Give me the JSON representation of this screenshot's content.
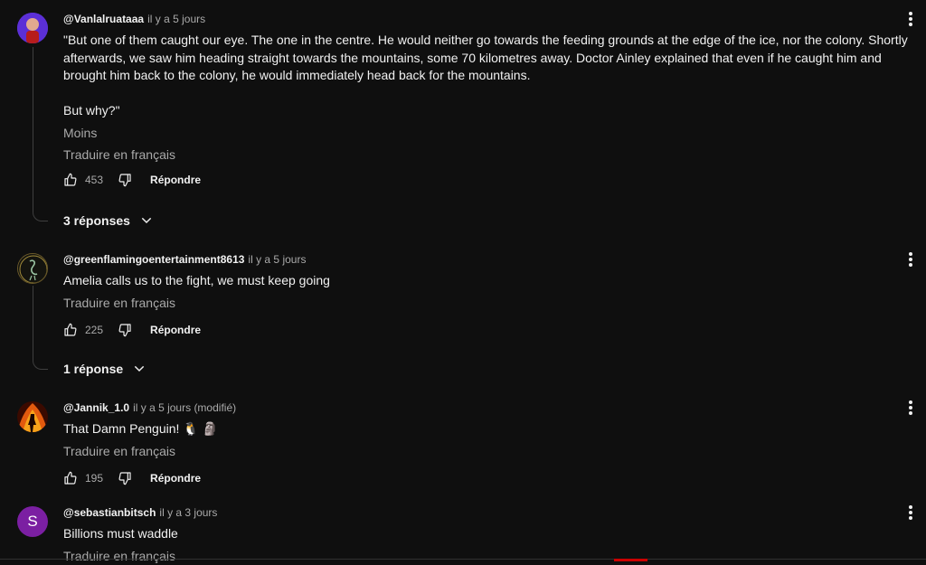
{
  "comments": [
    {
      "author": "@Vanlalruataaa",
      "time": "il y a 5 jours",
      "paragraph1": "\"But one of them caught our eye. The one in the centre. He would neither go towards the feeding grounds at the edge of the ice, nor the colony. Shortly afterwards, we saw him heading straight towards the mountains, some 70 kilometres away. Doctor Ainley explained that even if he caught him and brought him back to the colony, he would immediately head back for the mountains.",
      "paragraph2": "But why?\"",
      "less_label": "Moins",
      "translate_label": "Traduire en français",
      "likes": "453",
      "reply_label": "Répondre",
      "replies_label": "3 réponses",
      "avatar_color": "#6a3de8"
    },
    {
      "author": "@greenflamingoentertainment8613",
      "time": "il y a 5 jours",
      "text": "Amelia calls us to the fight, we must keep going",
      "translate_label": "Traduire en français",
      "likes": "225",
      "reply_label": "Répondre",
      "replies_label": "1 réponse"
    },
    {
      "author": "@Jannik_1.0",
      "time": "il y a 5 jours (modifié)",
      "text": "That Damn Penguin! 🐧 🗿",
      "translate_label": "Traduire en français",
      "likes": "195",
      "reply_label": "Répondre"
    },
    {
      "author": "@sebastianbitsch",
      "time": "il y a 3 jours",
      "text": "Billions must waddle",
      "translate_label": "Traduire en français",
      "avatar_letter": "S",
      "avatar_color": "#7b1fa2"
    }
  ]
}
